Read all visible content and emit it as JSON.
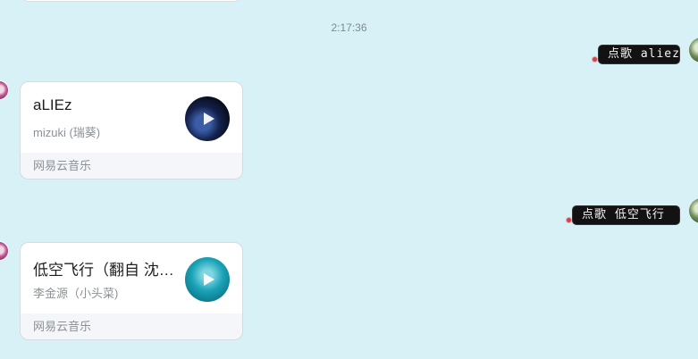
{
  "timestamp": "2:17:36",
  "messages": [
    {
      "text": "点歌 aliez"
    },
    {
      "text": "点歌 低空飞行"
    }
  ],
  "music_cards": [
    {
      "title": "aLIEz",
      "artist": "mizuki (瑞葵)",
      "source": "网易云音乐"
    },
    {
      "title": "低空飞行（翻自 沈以诚）",
      "artist": "李金源（小头菜)",
      "source": "网易云音乐"
    }
  ],
  "icons": [
    "play-icon",
    "error-icon"
  ],
  "colors": {
    "background": "#d8f1f7",
    "bubble": "#121212",
    "error": "#c8464f"
  }
}
